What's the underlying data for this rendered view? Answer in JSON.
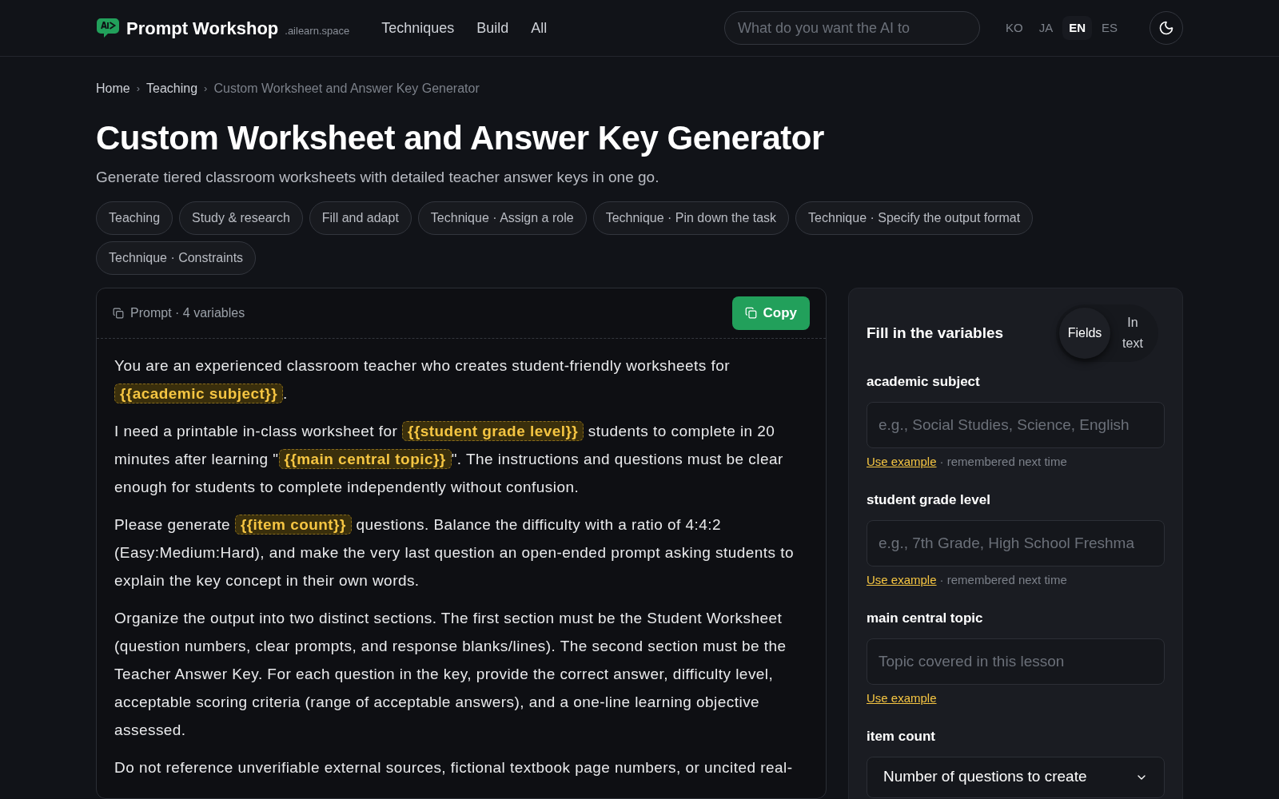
{
  "header": {
    "brand": "Prompt Workshop",
    "domain": ".ailearn.space",
    "nav": [
      "Techniques",
      "Build",
      "All"
    ],
    "search": {
      "placeholder": "What do you want the AI to"
    },
    "languages": [
      {
        "label": "KO",
        "selected": false
      },
      {
        "label": "JA",
        "selected": false
      },
      {
        "label": "EN",
        "selected": true
      },
      {
        "label": "ES",
        "selected": false
      }
    ]
  },
  "breadcrumb_separator": "›",
  "breadcrumb": [
    {
      "label": "Home",
      "current": false
    },
    {
      "label": "Teaching",
      "current": false
    },
    {
      "label": "Custom Worksheet and Answer Key Generator",
      "current": true
    }
  ],
  "title": "Custom Worksheet and Answer Key Generator",
  "subtitle": "Generate tiered classroom worksheets with detailed teacher answer keys in one go.",
  "tags": [
    "Teaching",
    "Study & research",
    "Fill and adapt",
    "Technique · Assign a role",
    "Technique · Pin down the task",
    "Technique · Specify the output format",
    "Technique · Constraints"
  ],
  "prompt": {
    "label": "Prompt · 4 variables",
    "copy_button": "Copy",
    "paragraphs": [
      [
        {
          "kind": "text",
          "text": "You are an experienced classroom teacher who creates student-friendly worksheets for "
        },
        {
          "kind": "variable",
          "text": "{{academic subject}}"
        },
        {
          "kind": "text",
          "text": "."
        }
      ],
      [
        {
          "kind": "text",
          "text": "I need a printable in-class worksheet for "
        },
        {
          "kind": "variable",
          "text": "{{student grade level}}"
        },
        {
          "kind": "text",
          "text": " students to complete in 20 minutes after learning \""
        },
        {
          "kind": "variable",
          "text": "{{main central topic}}"
        },
        {
          "kind": "text",
          "text": "\". The instructions and questions must be clear enough for students to complete independently without confusion."
        }
      ],
      [
        {
          "kind": "text",
          "text": "Please generate "
        },
        {
          "kind": "variable",
          "text": "{{item count}}"
        },
        {
          "kind": "text",
          "text": " questions. Balance the difficulty with a ratio of 4:4:2 (Easy:Medium:Hard), and make the very last question an open-ended prompt asking students to explain the key concept in their own words."
        }
      ],
      [
        {
          "kind": "text",
          "text": "Organize the output into two distinct sections. The first section must be the Student Worksheet (question numbers, clear prompts, and response blanks/lines). The second section must be the Teacher Answer Key. For each question in the key, provide the correct answer, difficulty level, acceptable scoring criteria (range of acceptable answers), and a one-line learning objective assessed."
        }
      ],
      [
        {
          "kind": "text",
          "text": "Do not reference unverifiable external sources, fictional textbook page numbers, or uncited real-"
        }
      ]
    ]
  },
  "variables_panel": {
    "title": "Fill in the variables",
    "modes": [
      {
        "label": "Fields",
        "selected": true
      },
      {
        "label": "In text",
        "selected": false
      }
    ],
    "fields": [
      {
        "label": "academic subject",
        "kind": "input",
        "placeholder": "e.g., Social Studies, Science, English",
        "example_link": "Use example",
        "note": "· remembered next time"
      },
      {
        "label": "student grade level",
        "kind": "input",
        "placeholder": "e.g., 7th Grade, High School Freshma",
        "example_link": "Use example",
        "note": "· remembered next time"
      },
      {
        "label": "main central topic",
        "kind": "input",
        "placeholder": "Topic covered in this lesson",
        "example_link": "Use example"
      },
      {
        "label": "item count",
        "kind": "select",
        "value": "Number of questions to create"
      }
    ]
  }
}
